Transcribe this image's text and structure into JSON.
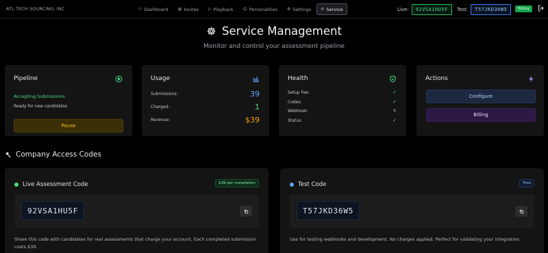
{
  "header": {
    "brand": "ATL TECH SOURCING, INC",
    "nav": [
      {
        "label": "Dashboard",
        "icon": "dashboard-icon",
        "glyph": "⚇"
      },
      {
        "label": "Invites",
        "icon": "invites-icon",
        "glyph": "▤"
      },
      {
        "label": "Playback",
        "icon": "playback-icon",
        "glyph": "▷"
      },
      {
        "label": "Personalities",
        "icon": "personalities-icon",
        "glyph": "☺"
      },
      {
        "label": "Settings",
        "icon": "settings-icon",
        "glyph": "⚙"
      },
      {
        "label": "Service",
        "icon": "service-icon",
        "glyph": "⚙"
      }
    ],
    "active_tab": "Service",
    "live_label": "Live:",
    "live_code": "92VSA1HU5F",
    "test_label": "Test:",
    "test_code": "T57JKD36W5",
    "billing_badge": "Billing"
  },
  "page": {
    "title": "Service Management",
    "subtitle": "Monitor and control your assessment pipeline"
  },
  "pipeline": {
    "title": "Pipeline",
    "state": "Accepting Submissions",
    "sub": "Ready for new candidates",
    "pause_label": "Pause"
  },
  "usage": {
    "title": "Usage",
    "rows": [
      {
        "label": "Submissions:",
        "value": "39",
        "color": "#60a5fa"
      },
      {
        "label": "Charged:",
        "value": "1",
        "color": "#4ade80"
      },
      {
        "label": "Revenue:",
        "value": "$39",
        "color": "#f59e0b"
      }
    ]
  },
  "health": {
    "title": "Health",
    "rows": [
      {
        "label": "Setup Fee:",
        "status": "ok"
      },
      {
        "label": "Codes:",
        "status": "ok"
      },
      {
        "label": "Webhook:",
        "status": "missing"
      },
      {
        "label": "Status:",
        "status": "ok"
      }
    ]
  },
  "actions": {
    "title": "Actions",
    "configure_label": "Configure",
    "billing_label": "Billing"
  },
  "access_codes": {
    "section_title": "Company Access Codes",
    "live": {
      "title": "Live Assessment Code",
      "tag": "$39 per completion",
      "code": "92VSA1HU5F",
      "desc": "Share this code with candidates for real assessments that charge your account. Each completed submission costs $39."
    },
    "test": {
      "title": "Test Code",
      "tag": "Free",
      "code": "T57JKD36W5",
      "desc": "Use for testing webhooks and development. No charges applied. Perfect for validating your integration."
    }
  },
  "colors": {
    "accent_green": "#4ade80",
    "accent_blue": "#60a5fa",
    "accent_amber": "#f59e0b",
    "accent_purple": "#a78bfa",
    "background": "#000000",
    "card": "#141414"
  }
}
